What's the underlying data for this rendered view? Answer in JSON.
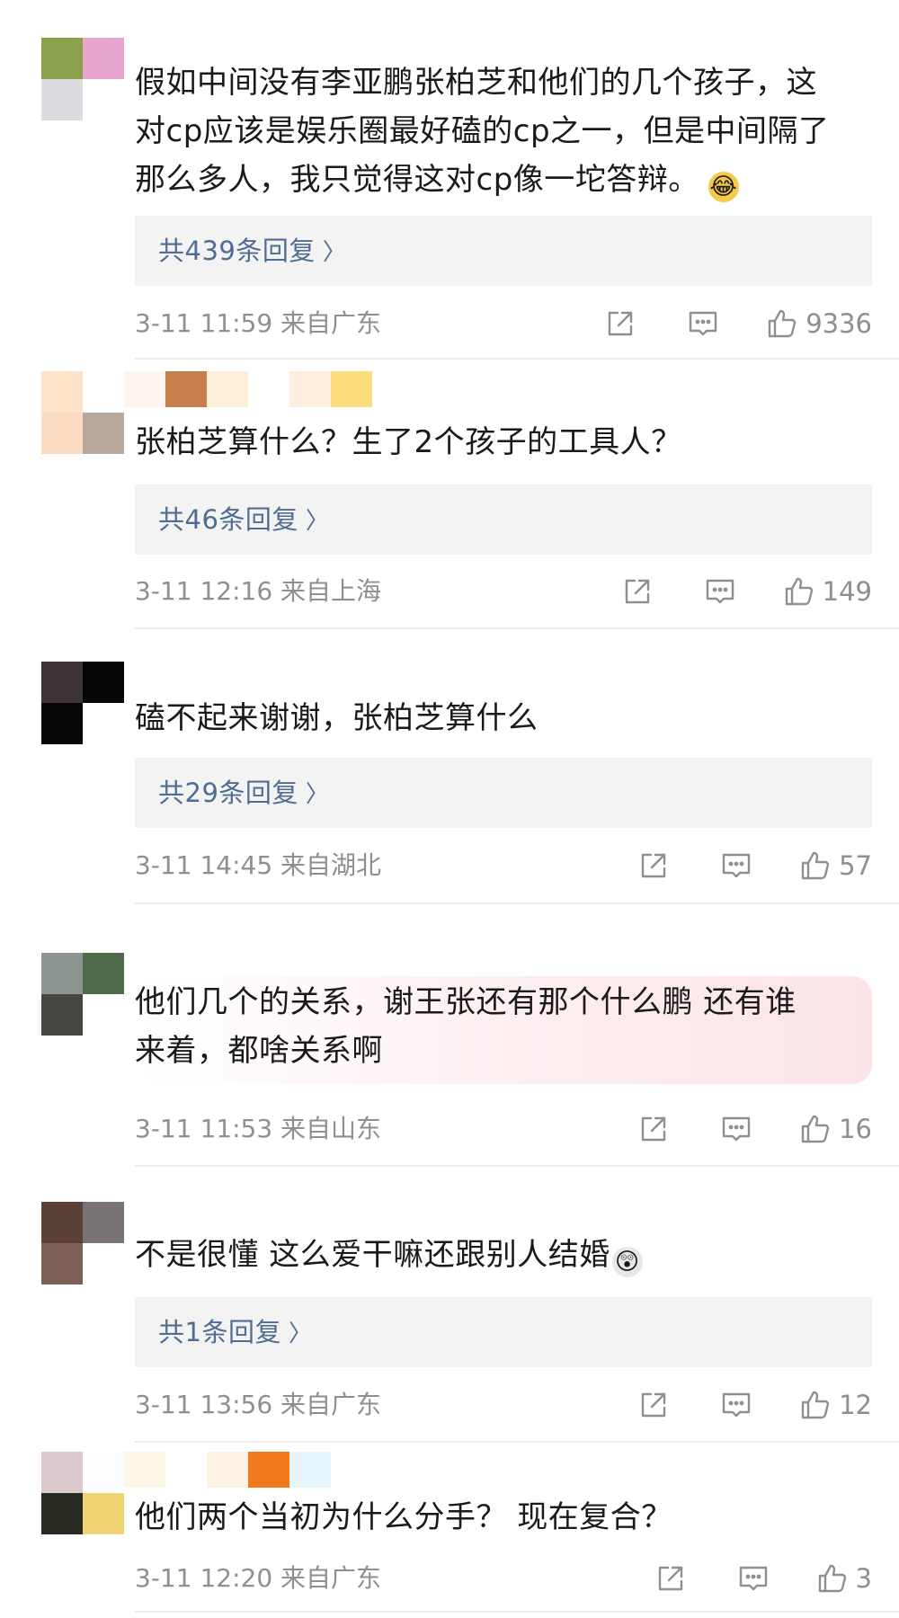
{
  "comments": [
    {
      "text_lines": [
        "假如中间没有李亚鹏张柏芝和他们的几个孩子，这",
        "对cp应该是娱乐圈最好磕的cp之一，但是中间隔了",
        "那么多人，我只觉得这对cp像一坨答辩。"
      ],
      "emoji": "laughing-crying-emoji",
      "replies_label": "共439条回复",
      "timestamp": "3-11 11:59",
      "location": "来自广东",
      "likes": "9336",
      "avatar_colors": [
        "#8aa04a",
        "#e8a6cf",
        "#dedbe0",
        "#ffffff"
      ]
    },
    {
      "text_lines": [
        "张柏芝算什么？生了2个孩子的工具人？"
      ],
      "replies_label": "共46条回复",
      "timestamp": "3-11 12:16",
      "location": "来自上海",
      "likes": "149",
      "avatar_colors": [
        "#fde4c8",
        "#ffffff",
        "#fcdcc0",
        "#b8a89c"
      ]
    },
    {
      "text_lines": [
        "磕不起来谢谢，张柏芝算什么"
      ],
      "replies_label": "共29条回复",
      "timestamp": "3-11 14:45",
      "location": "来自湖北",
      "likes": "57",
      "avatar_colors": [
        "#3d3236",
        "#050505",
        "#070707",
        "#ffffff"
      ]
    },
    {
      "text_lines": [
        "他们几个的关系，谢王张还有那个什么鹏 还有谁",
        "来着，都啥关系啊"
      ],
      "timestamp": "3-11 11:53",
      "location": "来自山东",
      "likes": "16",
      "avatar_colors": [
        "#8c958f",
        "#4f6b4c",
        "#474743",
        "#ffffff"
      ]
    },
    {
      "text_lines": [
        "不是很懂 这么爱干嘛还跟别人结婚"
      ],
      "emoji": "surprised-emoji",
      "replies_label": "共1条回复",
      "timestamp": "3-11 13:56",
      "location": "来自广东",
      "likes": "12",
      "avatar_colors": [
        "#5b4135",
        "#787277",
        "#7d5f55",
        "#ffffff"
      ]
    },
    {
      "text_lines": [
        "他们两个当初为什么分手？ 现在复合？"
      ],
      "timestamp": "3-11 12:20",
      "location": "来自广东",
      "likes": "3",
      "avatar_colors": [
        "#dbc9cd",
        "#fcfdff",
        "#262a21",
        "#f2d374"
      ]
    }
  ],
  "icons": {
    "share": "share-icon",
    "comment": "comment-icon",
    "like": "thumbs-up-icon"
  },
  "colors": {
    "reply_link": "#4e6d92",
    "meta_gray": "#8f8f8f",
    "reply_bg": "#f3f3f3"
  }
}
